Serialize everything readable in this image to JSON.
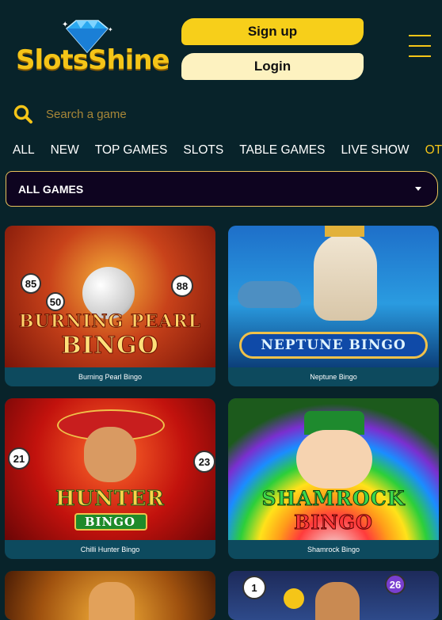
{
  "brand": {
    "logo_text": "SlotsShine"
  },
  "header": {
    "signup_label": "Sign up",
    "login_label": "Login"
  },
  "search": {
    "placeholder": "Search a game"
  },
  "tabs": [
    {
      "label": "ALL"
    },
    {
      "label": "NEW"
    },
    {
      "label": "TOP GAMES"
    },
    {
      "label": "SLOTS"
    },
    {
      "label": "TABLE GAMES"
    },
    {
      "label": "LIVE SHOW"
    },
    {
      "label": "OTH"
    }
  ],
  "filter": {
    "selected": "ALL GAMES"
  },
  "games": [
    {
      "name": "Burning Pearl Bingo",
      "art_title": "BURNING PEARL",
      "art_sub": "BINGO"
    },
    {
      "name": "Neptune Bingo",
      "art_title": "NEPTUNE",
      "art_sub": "BINGO"
    },
    {
      "name": "Chilli Hunter Bingo",
      "art_title": "HUNTER",
      "art_sub": "BINGO"
    },
    {
      "name": "Shamrock Bingo",
      "art_title": "SHAMROCK",
      "art_sub": "BINGO"
    }
  ],
  "balls": {
    "b1": "85",
    "b2": "50",
    "b3": "88",
    "b4": "21",
    "b5": "23",
    "b6": "1",
    "b7": "26"
  },
  "colors": {
    "accent": "#f5c518",
    "background": "#08232a",
    "card": "#0d4a5e"
  }
}
